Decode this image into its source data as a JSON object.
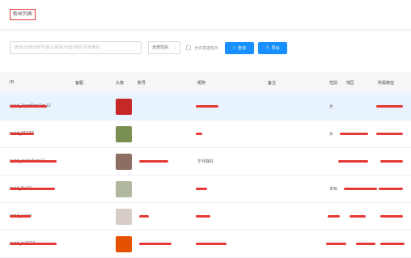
{
  "header": {
    "title": "粉丝列表"
  },
  "toolbar": {
    "search_placeholder": "微信ID/微信账号/备注/昵称/标签/地区/所属微信",
    "gender_select": "全部性别",
    "checkbox_label": "允许发送名片",
    "search_button": "查询",
    "export_button": "导出"
  },
  "table": {
    "columns": [
      "ID",
      "客服",
      "头像",
      "账号",
      "昵称",
      "备注",
      "性别",
      "地区",
      "所属微信"
    ],
    "rows": [
      {
        "id": "wxid_2rop8km1m22",
        "account": "",
        "nickname": "",
        "note": "",
        "gender": "女",
        "region": "",
        "owner": "",
        "avatar_color": "#c62828",
        "highlight": true
      },
      {
        "id": "wxid_05733",
        "account": "",
        "nickname": "",
        "note": "",
        "gender": "女",
        "region": "",
        "owner": "",
        "avatar_color": "#7a8f52",
        "highlight": false
      },
      {
        "id": "wxid_xy2n7um11",
        "account": "",
        "nickname": "岁月静好",
        "note": "",
        "gender": "",
        "region": "",
        "owner": "",
        "avatar_color": "#8d6e63",
        "highlight": false
      },
      {
        "id": "wxid_9u22",
        "account": "",
        "nickname": "",
        "note": "",
        "gender": "未知",
        "region": "",
        "owner": "",
        "avatar_color": "#b0b8a0",
        "highlight": false
      },
      {
        "id": "wxid_uyige",
        "account": "",
        "nickname": "",
        "note": "",
        "gender": "",
        "region": "",
        "owner": "",
        "avatar_color": "#d7ccc8",
        "highlight": false
      },
      {
        "id": "wxid_lo4722",
        "account": "",
        "nickname": "",
        "note": "",
        "gender": "",
        "region": "",
        "owner": "",
        "avatar_color": "#e65100",
        "highlight": false
      }
    ]
  }
}
